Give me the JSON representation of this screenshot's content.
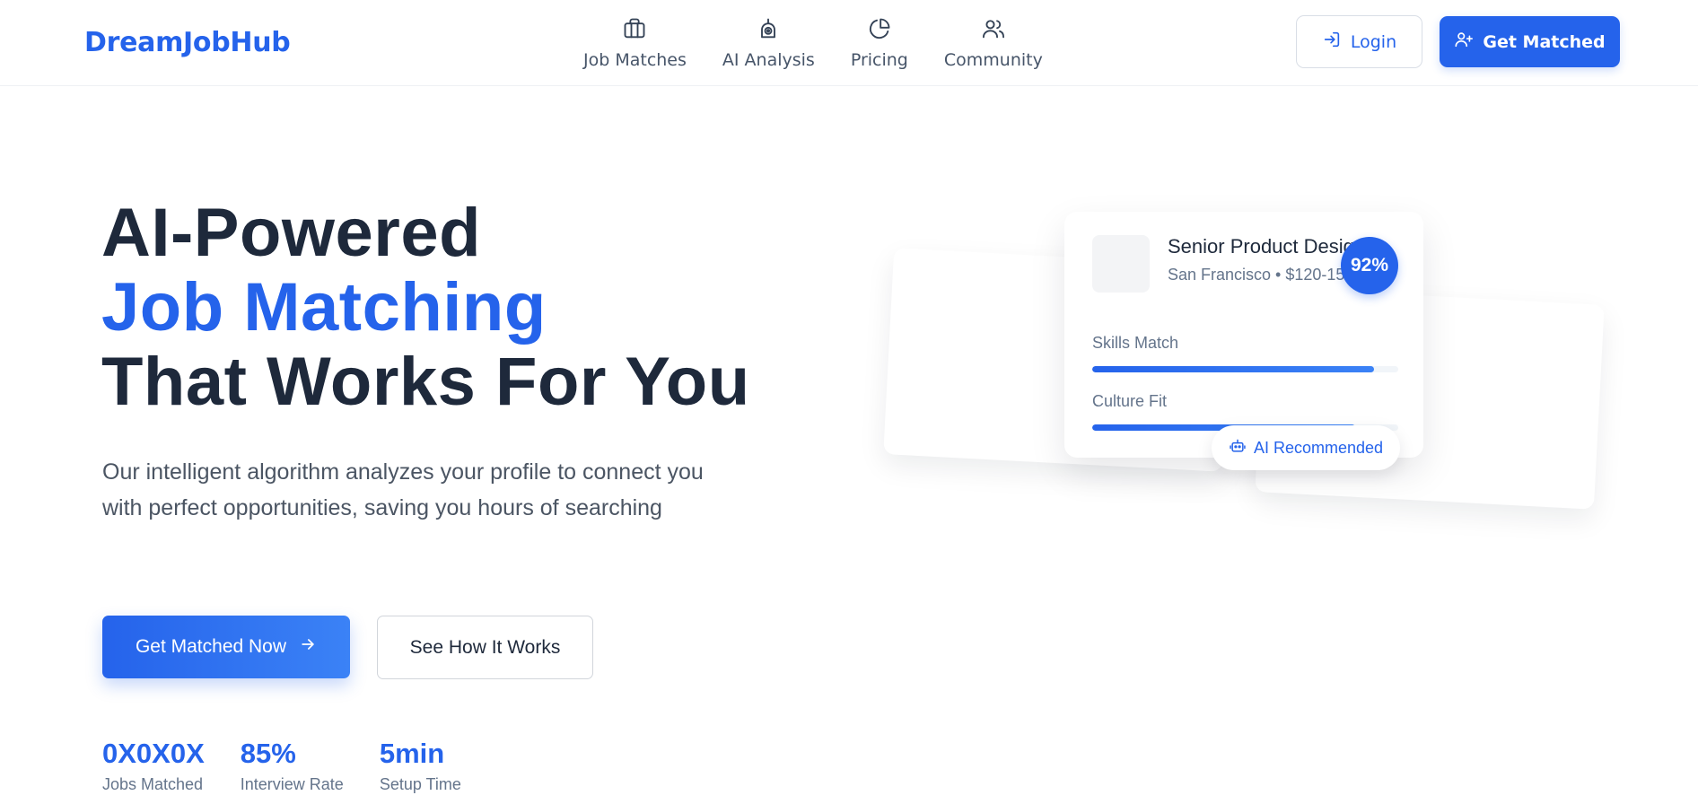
{
  "brand": {
    "name": "DreamJobHub",
    "accent": "#2563eb"
  },
  "nav": {
    "items": [
      {
        "label": "Job Matches",
        "icon": "briefcase-icon"
      },
      {
        "label": "AI Analysis",
        "icon": "robot-icon"
      },
      {
        "label": "Pricing",
        "icon": "pie-chart-icon"
      },
      {
        "label": "Community",
        "icon": "users-icon"
      }
    ]
  },
  "header": {
    "login_label": "Login",
    "login_icon": "sign-in-icon",
    "get_matched_label": "Get Matched",
    "get_matched_icon": "user-plus-icon"
  },
  "hero": {
    "title_line1": "AI-Powered",
    "title_line2": "Job Matching",
    "title_line3": "That Works For You",
    "subtitle": "Our intelligent algorithm analyzes your profile to connect you with perfect opportunities, saving you hours of searching",
    "primary_cta": "Get Matched Now",
    "primary_cta_icon": "arrow-right-icon",
    "secondary_cta": "See How It Works"
  },
  "stats": [
    {
      "value": "0X0X0X",
      "label": "Jobs Matched"
    },
    {
      "value": "85%",
      "label": "Interview Rate"
    },
    {
      "value": "5min",
      "label": "Setup Time"
    }
  ],
  "job_card": {
    "title": "Senior Product Designer",
    "meta": "San Francisco • $120-150K",
    "match": "92%",
    "metrics": [
      {
        "label": "Skills Match",
        "fill": 0.92
      },
      {
        "label": "Culture Fit",
        "fill": 0.86
      }
    ],
    "chip_label": "AI Recommended",
    "chip_icon": "robot-icon"
  }
}
